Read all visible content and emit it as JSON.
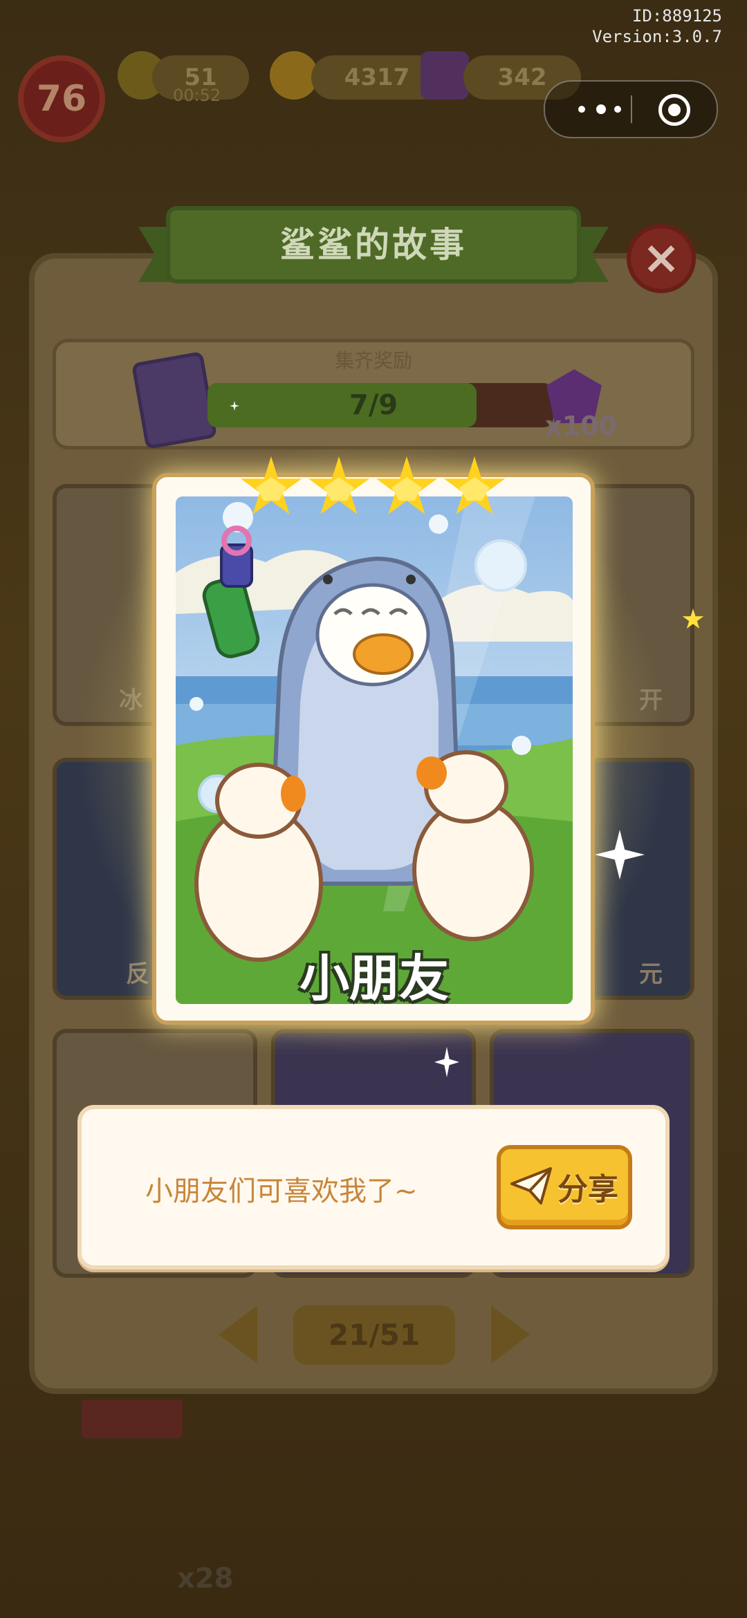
{
  "system": {
    "id_text": "ID:889125",
    "version_text": "Version:3.0.7"
  },
  "hud": {
    "level": "76",
    "energy": "51",
    "energy_timer": "00:52",
    "coins": "4317",
    "gems": "342"
  },
  "album": {
    "title": "鲨鲨的故事",
    "reward_label": "集齐奖励",
    "progress_text": "7/9",
    "progress_collected": 7,
    "progress_total": 9,
    "reward_amount": "x100",
    "page": "21/51",
    "cards_visible": [
      {
        "label": "冰"
      },
      {
        "label": "开"
      },
      {
        "label": "反"
      },
      {
        "label": "元"
      }
    ],
    "bottom_badge": "x28"
  },
  "featured_card": {
    "name": "小朋友",
    "stars": 4
  },
  "dialog": {
    "text": "小朋友们可喜欢我了~",
    "share_label": "分享"
  },
  "colors": {
    "star": "#ffd21f",
    "share_button": "#f6c230",
    "dialog_text": "#c8853a",
    "card_border": "#c9a15a"
  }
}
